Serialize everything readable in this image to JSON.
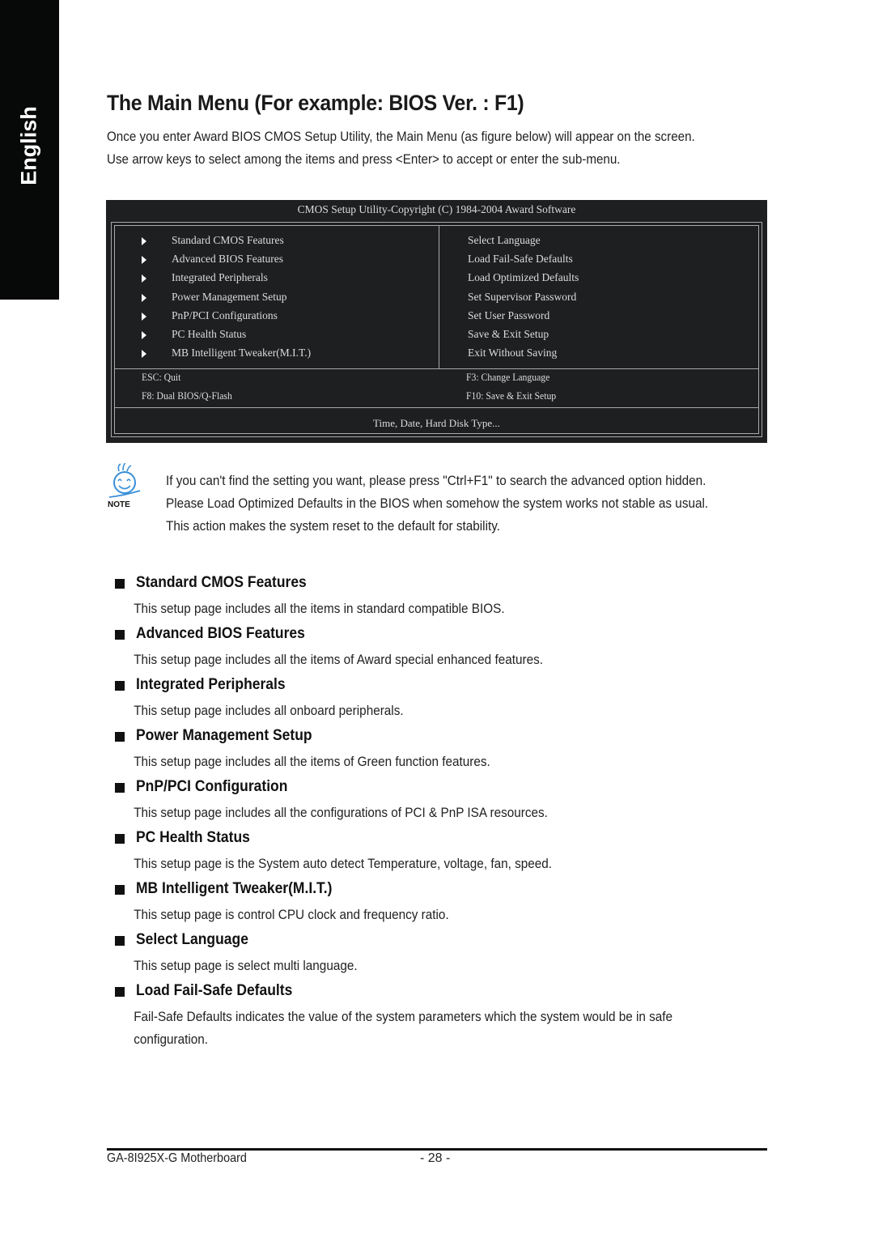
{
  "side_tab": {
    "label": "English",
    "background": "#070808"
  },
  "title": "The Main Menu (For example: BIOS Ver. : F1)",
  "intro": [
    "Once you enter Award BIOS CMOS Setup Utility, the Main Menu (as figure below) will appear on the screen.",
    "Use arrow keys to select among the items and press <Enter> to accept or enter the sub-menu."
  ],
  "bios_screen": {
    "title": "CMOS Setup Utility-Copyright (C) 1984-2004 Award Software",
    "left_menu": [
      "Standard CMOS Features",
      "Advanced BIOS Features",
      "Integrated Peripherals",
      "Power Management Setup",
      "PnP/PCI Configurations",
      "PC Health Status",
      "MB Intelligent Tweaker(M.I.T.)"
    ],
    "right_menu": [
      "Select Language",
      "Load Fail-Safe Defaults",
      "Load Optimized Defaults",
      "Set Supervisor Password",
      "Set User Password",
      "Save & Exit Setup",
      "Exit Without Saving"
    ],
    "keys": {
      "esc": "ESC: Quit",
      "f3": "F3: Change Language",
      "f8": "F8: Dual BIOS/Q-Flash",
      "f10": "F10: Save & Exit Setup"
    },
    "help_text": "Time, Date, Hard Disk Type...",
    "background": "#1d1f20"
  },
  "note": {
    "icon_label": "NOTE",
    "lines": [
      "If you can't find the setting you want, please press \"Ctrl+F1\" to search the advanced option hidden.",
      "Please Load Optimized Defaults in the BIOS when somehow the system works not stable as usual.",
      "This action makes the system reset to the default for stability."
    ],
    "accent": "#3a8fd8"
  },
  "sections": [
    {
      "title": "Standard CMOS Features",
      "desc": "This setup page includes all the items in standard compatible BIOS."
    },
    {
      "title": "Advanced BIOS Features",
      "desc": "This setup page includes all the items of Award special enhanced features."
    },
    {
      "title": "Integrated Peripherals",
      "desc": "This setup page includes all onboard peripherals."
    },
    {
      "title": "Power Management Setup",
      "desc": "This setup page includes all the items of Green function features."
    },
    {
      "title": "PnP/PCI Configuration",
      "desc": "This setup page includes all the configurations of PCI & PnP ISA resources."
    },
    {
      "title": "PC Health Status",
      "desc": "This setup page is the System auto detect Temperature, voltage, fan, speed."
    },
    {
      "title": "MB Intelligent Tweaker(M.I.T.)",
      "desc": "This setup page is control CPU clock and frequency ratio."
    },
    {
      "title": "Select Language",
      "desc": "This setup page is select multi language."
    },
    {
      "title": "Load Fail-Safe Defaults",
      "desc": "Fail-Safe Defaults indicates the value of the system parameters which the system would be in safe configuration."
    }
  ],
  "footer": {
    "product": "GA-8I925X-G Motherboard",
    "page": "- 28 -"
  }
}
